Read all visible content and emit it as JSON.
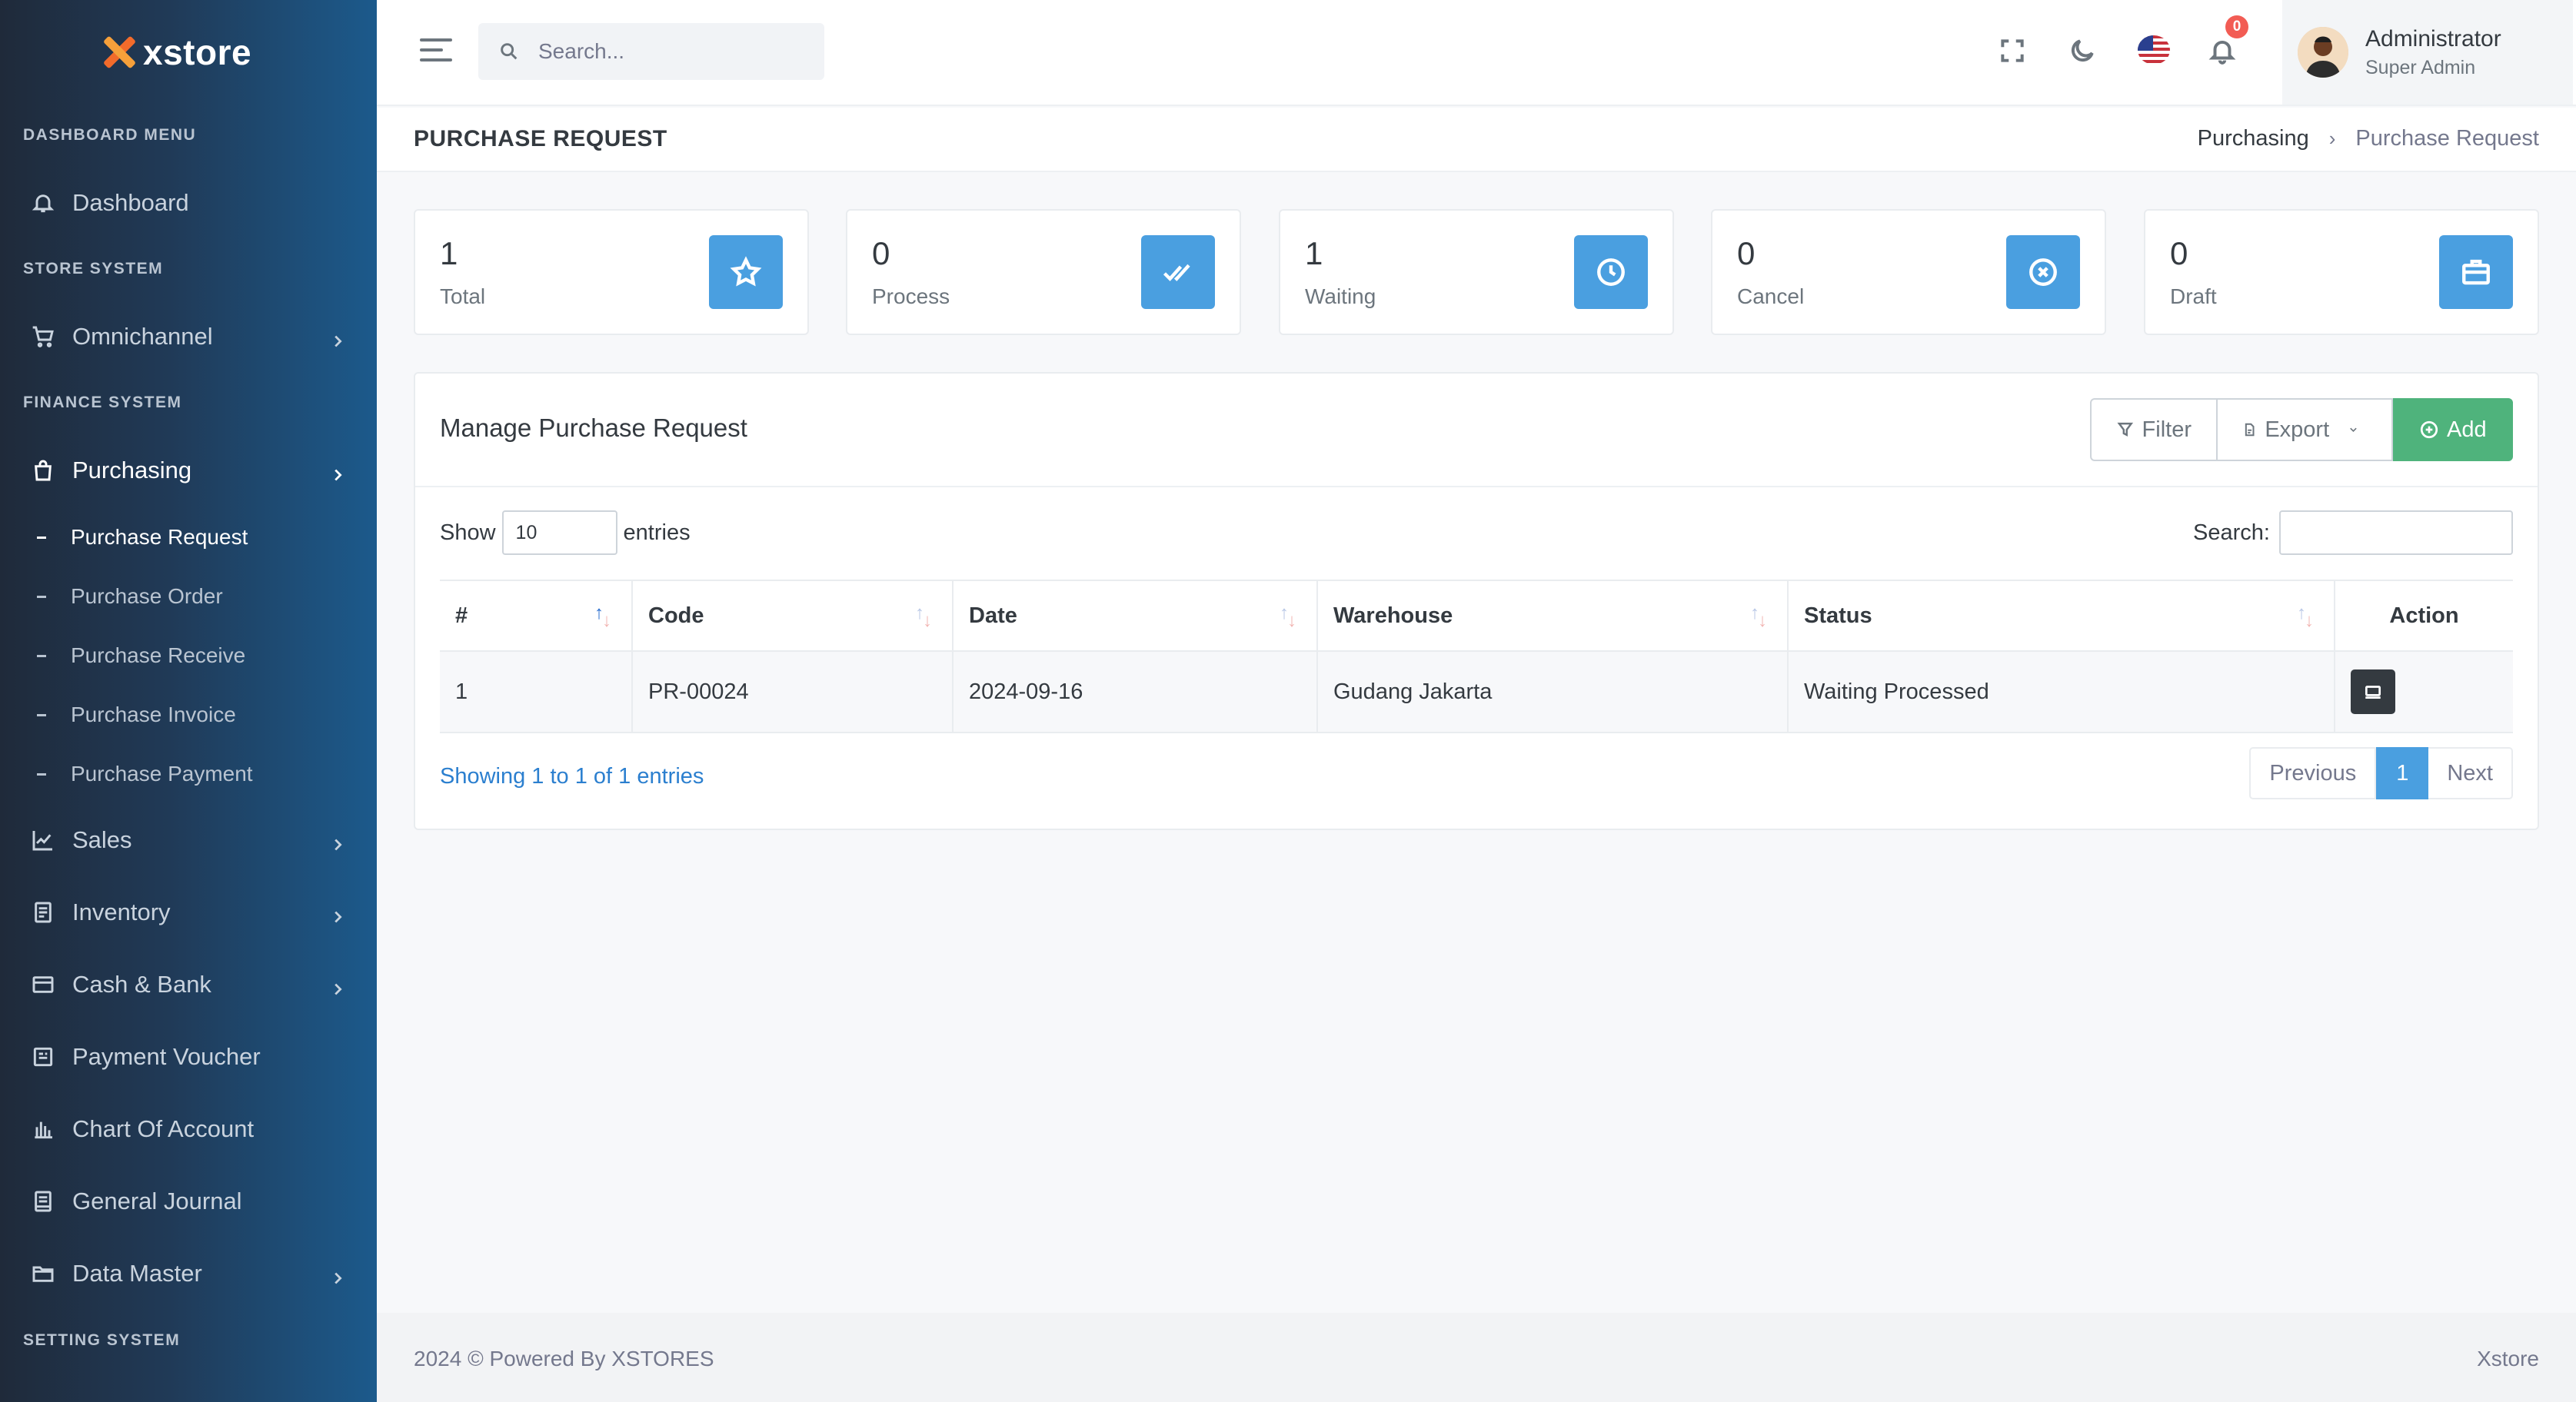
{
  "brand": {
    "name": "xstore"
  },
  "sidebar": {
    "sections": {
      "dashboard_menu": "DASHBOARD MENU",
      "store_system": "STORE SYSTEM",
      "finance_system": "FINANCE SYSTEM",
      "setting_system": "SETTING SYSTEM"
    },
    "items": {
      "dashboard": "Dashboard",
      "omnichannel": "Omnichannel",
      "purchasing": "Purchasing",
      "sales": "Sales",
      "inventory": "Inventory",
      "cash_bank": "Cash & Bank",
      "payment_voucher": "Payment Voucher",
      "chart_of_account": "Chart Of Account",
      "general_journal": "General Journal",
      "data_master": "Data Master"
    },
    "purchasing_sub": {
      "purchase_request": "Purchase Request",
      "purchase_order": "Purchase Order",
      "purchase_receive": "Purchase Receive",
      "purchase_invoice": "Purchase Invoice",
      "purchase_payment": "Purchase Payment"
    },
    "active_item": "Purchasing",
    "active_sub": "Purchase Request"
  },
  "topbar": {
    "search_placeholder": "Search...",
    "notification_count": "0",
    "user_name": "Administrator",
    "user_role": "Super Admin"
  },
  "page": {
    "title": "PURCHASE REQUEST",
    "breadcrumb": [
      "Purchasing",
      "Purchase Request"
    ]
  },
  "stats": [
    {
      "value": "1",
      "label": "Total",
      "icon": "star-icon"
    },
    {
      "value": "0",
      "label": "Process",
      "icon": "double-check-icon"
    },
    {
      "value": "1",
      "label": "Waiting",
      "icon": "clock-icon"
    },
    {
      "value": "0",
      "label": "Cancel",
      "icon": "circle-x-icon"
    },
    {
      "value": "0",
      "label": "Draft",
      "icon": "briefcase-icon"
    }
  ],
  "panel": {
    "title": "Manage Purchase Request",
    "filter_label": "Filter",
    "export_label": "Export",
    "add_label": "Add",
    "show_label": "Show",
    "entries_label": "entries",
    "page_length": "10",
    "search_label": "Search:",
    "columns": [
      "#",
      "Code",
      "Date",
      "Warehouse",
      "Status",
      "Action"
    ],
    "rows": [
      {
        "no": "1",
        "code": "PR-00024",
        "date": "2024-09-16",
        "warehouse": "Gudang Jakarta",
        "status": "Waiting Processed"
      }
    ],
    "info": "Showing 1 to 1 of 1 entries",
    "pager": {
      "previous": "Previous",
      "current": "1",
      "next": "Next"
    }
  },
  "footer": {
    "left": "2024 © Powered By XSTORES",
    "right": "Xstore"
  },
  "colors": {
    "accent": "#4a9fe0",
    "success": "#4fb37c",
    "badge": "#f25c54",
    "sidebar_start": "#1f2a3a",
    "sidebar_end": "#1c5a8c"
  }
}
